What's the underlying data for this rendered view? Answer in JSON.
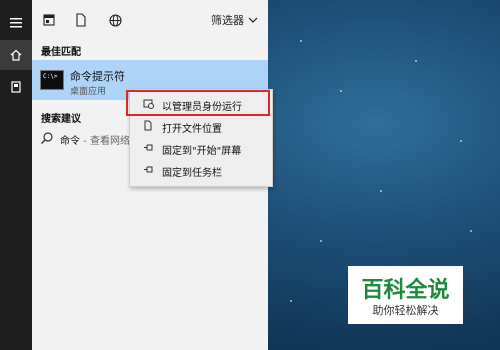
{
  "filter": {
    "label": "筛选器"
  },
  "sections": {
    "best_match": "最佳匹配",
    "search_suggestions": "搜索建议"
  },
  "best_match": {
    "title": "命令提示符",
    "subtitle": "桌面应用"
  },
  "suggestion": {
    "query": "命令",
    "separator": " - ",
    "hint": "查看网络"
  },
  "context_menu": {
    "items": [
      {
        "label": "以管理员身份运行",
        "icon": "run-as-admin-icon"
      },
      {
        "label": "打开文件位置",
        "icon": "file-location-icon"
      },
      {
        "label": "固定到\"开始\"屏幕",
        "icon": "pin-icon"
      },
      {
        "label": "固定到任务栏",
        "icon": "pin-icon"
      }
    ]
  },
  "watermark": {
    "title": "百科全说",
    "subtitle": "助你轻松解决"
  },
  "colors": {
    "panel_bg": "#f2f2f2",
    "selected_bg": "#add4f7",
    "rail_bg": "#1f1f1f",
    "highlight": "#e1262b",
    "watermark_green": "#1d8b3c"
  }
}
